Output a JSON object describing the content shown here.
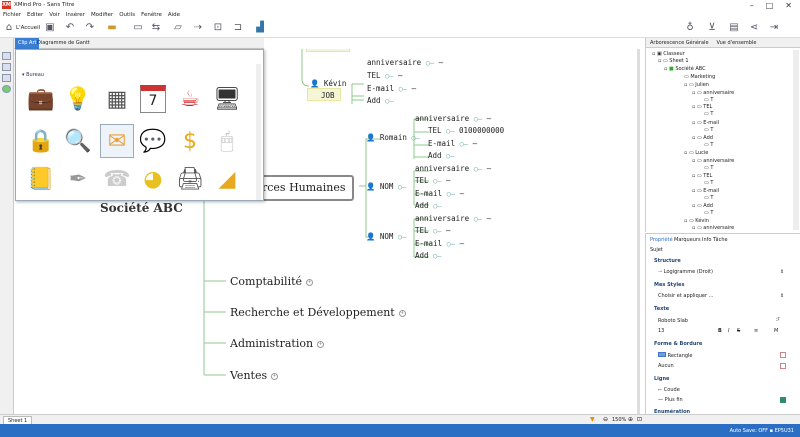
{
  "app": {
    "title": "XMind Pro - Sans Titre",
    "logo": "XM"
  },
  "menu": [
    "Fichier",
    "Editer",
    "Voir",
    "Insérer",
    "Modifier",
    "Outils",
    "Fenêtre",
    "Aide"
  ],
  "toolbar": {
    "home_label": "L'Accueil"
  },
  "left_tabs": {
    "clipart": "Clip Art",
    "gantt": "Diagramme de Gantt"
  },
  "clipart": {
    "section": "Bureau",
    "icons": [
      "briefcase-icon",
      "lightbulb-icon",
      "calculator-icon",
      "calendar-icon",
      "coffee-cup-icon",
      "monitor-icon",
      "lock-icon",
      "magnifier-icon",
      "envelope-icon",
      "chat-bubbles-icon",
      "dollar-coin-icon",
      "mouse-icon",
      "notebook-icon",
      "pen-icon",
      "phone-icon",
      "pie-chart-icon",
      "printer-icon",
      "ruler-triangle-icon"
    ],
    "calendar_day": "7"
  },
  "map": {
    "central": "Société ABC",
    "hr": "rces Humaines",
    "job": "JOB",
    "kevin": "Kévin",
    "romain": "Romain",
    "nom1": "NOM",
    "nom2": "NOM",
    "anniv": "anniversaire",
    "tel": "TEL",
    "email": "E-mail",
    "add": "Add",
    "phone_value": "0100000000",
    "dash": "—",
    "branches": [
      "Comptabilité",
      "Recherche et Développement",
      "Administration",
      "Ventes"
    ]
  },
  "outline": {
    "tabs": [
      "Arborescence Générale",
      "Vue d'ensemble"
    ],
    "items": [
      "Classeur",
      "Sheet 1",
      "Société ABC",
      "Marketing",
      "Julien",
      "anniversaire",
      "TEL",
      "E-mail",
      "Add",
      "Lucie",
      "anniversaire",
      "TEL",
      "E-mail",
      "Add",
      "Kévin",
      "anniversaire"
    ],
    "empty_marker": "T"
  },
  "properties": {
    "tabs": [
      "Propriété",
      "Marqueurs",
      "Info Tâche"
    ],
    "subject": "Sujet",
    "sections": {
      "structure": "Structure",
      "styles": "Mes Styles",
      "text": "Texte",
      "shape": "Forme & Bordure",
      "line": "Ligne",
      "numbering": "Enumération"
    },
    "structure_value": "Logigramme (Droit)",
    "style_value": "Choisir et appliquer ...",
    "font": "Roboto Slab",
    "font_size": "13",
    "text_format": {
      "bold": "B",
      "italic": "I",
      "strike": "S",
      "list": "≡",
      "more": "M"
    },
    "shape_value": "Rectangle",
    "border_value": "Aucun",
    "line_value": "Coude",
    "line_width": "Plus fin"
  },
  "bottom": {
    "sheet": "Sheet 1",
    "zoom": "150%"
  },
  "status": {
    "autosave": "Auto Save: OFF ▪ EP5U31"
  },
  "colors": {
    "accent": "#2b6fc4",
    "root_border": "#888",
    "line": "#8fc88f"
  }
}
